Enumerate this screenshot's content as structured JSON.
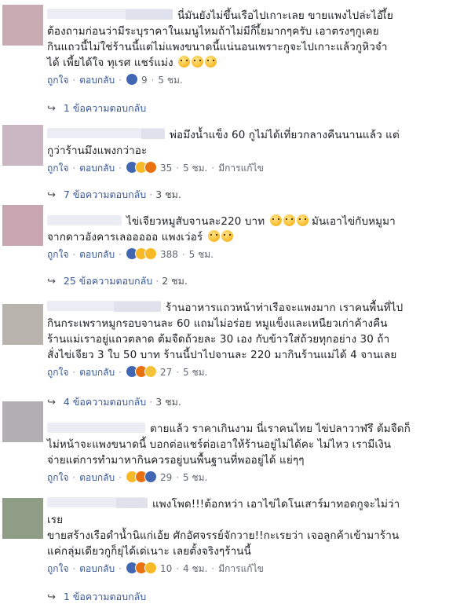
{
  "labels": {
    "like": "ถูกใจ",
    "reply": "ตอบกลับ",
    "edited": "มีการแก้ไข"
  },
  "comments": [
    {
      "lines": [
        "นี่มันยังไม่ขึ้นเรือไปเกาะเลย ขายแพงไปล่ะไอ้เี้ย",
        "ต้องถามก่อนว่ามีระบุราคาในเมนูไหมถ้าไม่มีก็เี้ยมากๆครับ เอาตรงๆกูเคย",
        "กินแถวนี้ไม่ใช่ร้านนี้แต่ไม่แพงขนาดนี้แน่นอนเพราะกูจะไปเกาะแล้วกูหิวจำ",
        "ได้ เพี้ยได้ใจ ทุเรศ แชร์แม่ง"
      ],
      "reaction_count": "9",
      "time": "5 ชม.",
      "replies": "1 ข้อความตอบกลับ",
      "replies_time": ""
    },
    {
      "lines": [
        "พ่อมึงน้ำแข็ง 60 กูไม่ได้เที่ยวกลางคืนนานแล้ว แต่",
        "กูว่าร้านมึงแพงกว่าอะ"
      ],
      "reaction_count": "35",
      "time": "5 ชม.",
      "edited": true,
      "replies": "7 ข้อความตอบกลับ",
      "replies_time": "3 ชม."
    },
    {
      "lines": [
        "ไข่เจียวหมูสับจานละ220 บาท",
        "จากดาวอังคารเลอออออ แพงเว่อร์"
      ],
      "tail_1": "มันเอาไข่กับหมูมา",
      "reaction_count": "388",
      "time": "5 ชม.",
      "replies": "25 ข้อความตอบกลับ",
      "replies_time": "2 ชม."
    },
    {
      "lines": [
        "ร้านอาหารแถวหน้าท่าเรือจะแพงมาก เราคนพื้นที่ไป",
        "กินกระเพราหมูกรอบจานละ 60 แถมไม่อร่อย หมูแข็งและเหนียวเก่าค้างคืน",
        "ร้านแม่เราอยู่แถวตลาด ต้มจืดถ้วยละ 30 เอง กับข้าวใส่ถ้วยทุกอย่าง 30 ถ้า",
        "สั่งไข่เจียว 3 ใบ 50 บาท ร้านนี้ปาไปจานละ 220 มากินร้านแม่ได้ 4 จานเลย"
      ],
      "reaction_count": "27",
      "time": "5 ชม.",
      "replies": "4 ข้อความตอบกลับ",
      "replies_time": "3 ชม."
    },
    {
      "lines": [
        "ตายแล้ว ราคาเกินงาม นี่เราคนไทย ไข่ปลาวาฬรึ ต้มจืดก็",
        "ไม่หน้าจะแพงขนาดนี้ บอกต่อแชร์ต่อเอาให้ร้านอยู่ไม่ได้คะ ไม่ไหว เรามีเงิน",
        "จ่ายแต่การทำมาหากินควรอยู่บนพื้นฐานที่พออยู่ได้ แย่ๆๆ"
      ],
      "reaction_count": "29",
      "time": "5 ชม.",
      "replies": "",
      "replies_time": ""
    },
    {
      "lines": [
        "แพงโพด!!!ต้อกหว่า เอาไข่ไดโนเสาร์มาทอดกูจะไม่ว่า",
        "เรย",
        "ขายสร้างเรือดำน้ำนิแก่เอ้ย ศักอัศจรรย์จักวาย!!กะเรยว่า เจอลูกค้าเข้ามาร้าน",
        "แค่กลุ่มเดียวกูก็ยุ่ได้เด่เนาะ เลยตั้งจริงๆร้านนี้"
      ],
      "reaction_count": "10",
      "time": "4 ชม.",
      "edited": true,
      "replies": "1 ข้อความตอบกลับ",
      "replies_time": ""
    }
  ],
  "colors": {
    "avatar": [
      "#c7aab2",
      "#cab6c3",
      "#c7a6b1",
      "#b9b3ad",
      "#b2afb3",
      "#8f9c86"
    ],
    "link": "#385898",
    "meta": "#606770"
  }
}
